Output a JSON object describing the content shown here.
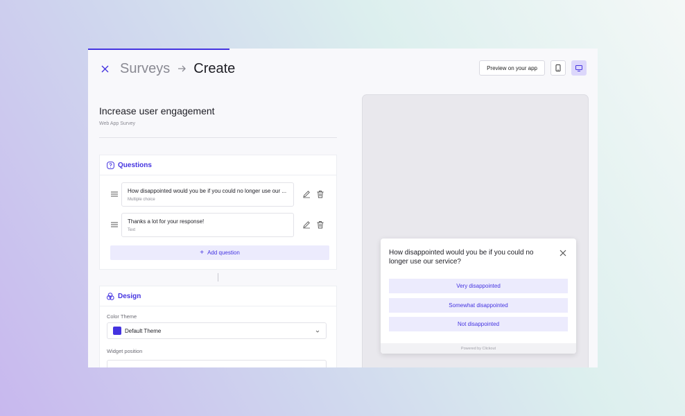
{
  "header": {
    "breadcrumb_root": "Surveys",
    "breadcrumb_current": "Create",
    "preview_button": "Preview on your app"
  },
  "survey": {
    "title": "Increase user engagement",
    "subtitle": "Web App Survey"
  },
  "questions_card": {
    "heading": "Questions",
    "items": [
      {
        "text": "How disappointed would you be if you could no longer use our ...",
        "type": "Multiple choice"
      },
      {
        "text": "Thanks a lot for your response!",
        "type": "Text"
      }
    ],
    "add_button": "Add question"
  },
  "design_card": {
    "heading": "Design",
    "color_theme_label": "Color Theme",
    "color_theme_value": "Default Theme",
    "widget_position_label": "Widget position"
  },
  "widget": {
    "question": "How disappointed would you be if you could no longer use our service?",
    "options": [
      "Very disappointed",
      "Somewhat disappointed",
      "Not disappointed"
    ],
    "footer": "Powered by Clickout"
  },
  "colors": {
    "accent": "#4433e0",
    "accent_soft": "#ecebfd"
  },
  "icons": {
    "close": "close-icon",
    "arrow": "arrow-right-icon",
    "mobile": "mobile-device-icon",
    "desktop": "desktop-device-icon",
    "questions": "question-circle-icon",
    "design": "palette-icon",
    "drag": "drag-handle-icon",
    "edit": "edit-icon",
    "delete": "trash-icon"
  }
}
